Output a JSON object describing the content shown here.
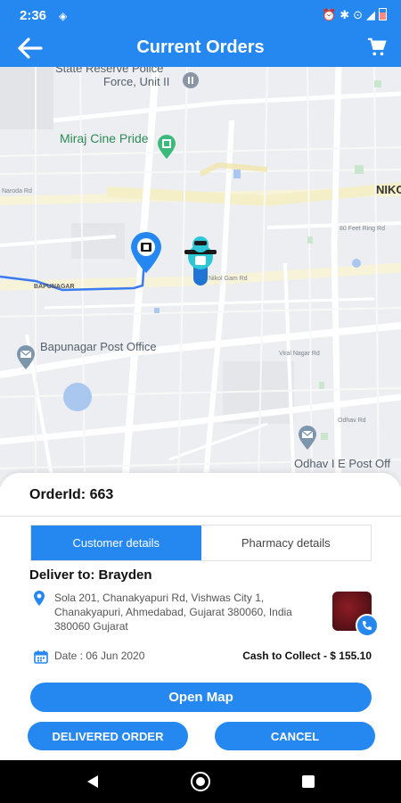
{
  "status_bar": {
    "time": "2:36",
    "icons": [
      "alarm-icon",
      "bluetooth-icon",
      "location-icon",
      "wifi-icon",
      "signal-icon",
      "battery-icon"
    ]
  },
  "header": {
    "title": "Current Orders",
    "back_icon": "arrow-left-icon",
    "cart_icon": "cart-icon",
    "color": "#2587f0"
  },
  "map": {
    "labels": {
      "reserve_top": "State Reserve Police",
      "reserve_bottom": "Force, Unit II",
      "cinema": "Miraj Cine Pride",
      "niko": "NIKO",
      "bapunagar": "BAPUNAGAR",
      "post_office": "Bapunagar Post Office",
      "odhav_post": "Odhav I E Post Off",
      "nikol_road": "Nikol Gam Rd",
      "feer_road": "80 Feet Ring Rd",
      "viral_road": "Viral Nagar Rd",
      "odhav_road": "Odhav Rd",
      "narol_road": "Naroda Rd"
    }
  },
  "order": {
    "order_id": "OrderId: 663",
    "tabs": [
      {
        "label": "Customer details",
        "active": true
      },
      {
        "label": "Pharmacy details",
        "active": false
      }
    ],
    "deliver_to": "Deliver to: Brayden",
    "address": "Sola 201, Chanakyapuri Rd, Vishwas City 1, Chanakyapuri, Ahmedabad, Gujarat 380060, India 380060 Gujarat",
    "date": "Date : 06 Jun 2020",
    "cash": "Cash to Collect - $ 155.10",
    "open_map": "Open Map",
    "delivered": "DELIVERED ORDER",
    "cancel": "CANCEL"
  }
}
